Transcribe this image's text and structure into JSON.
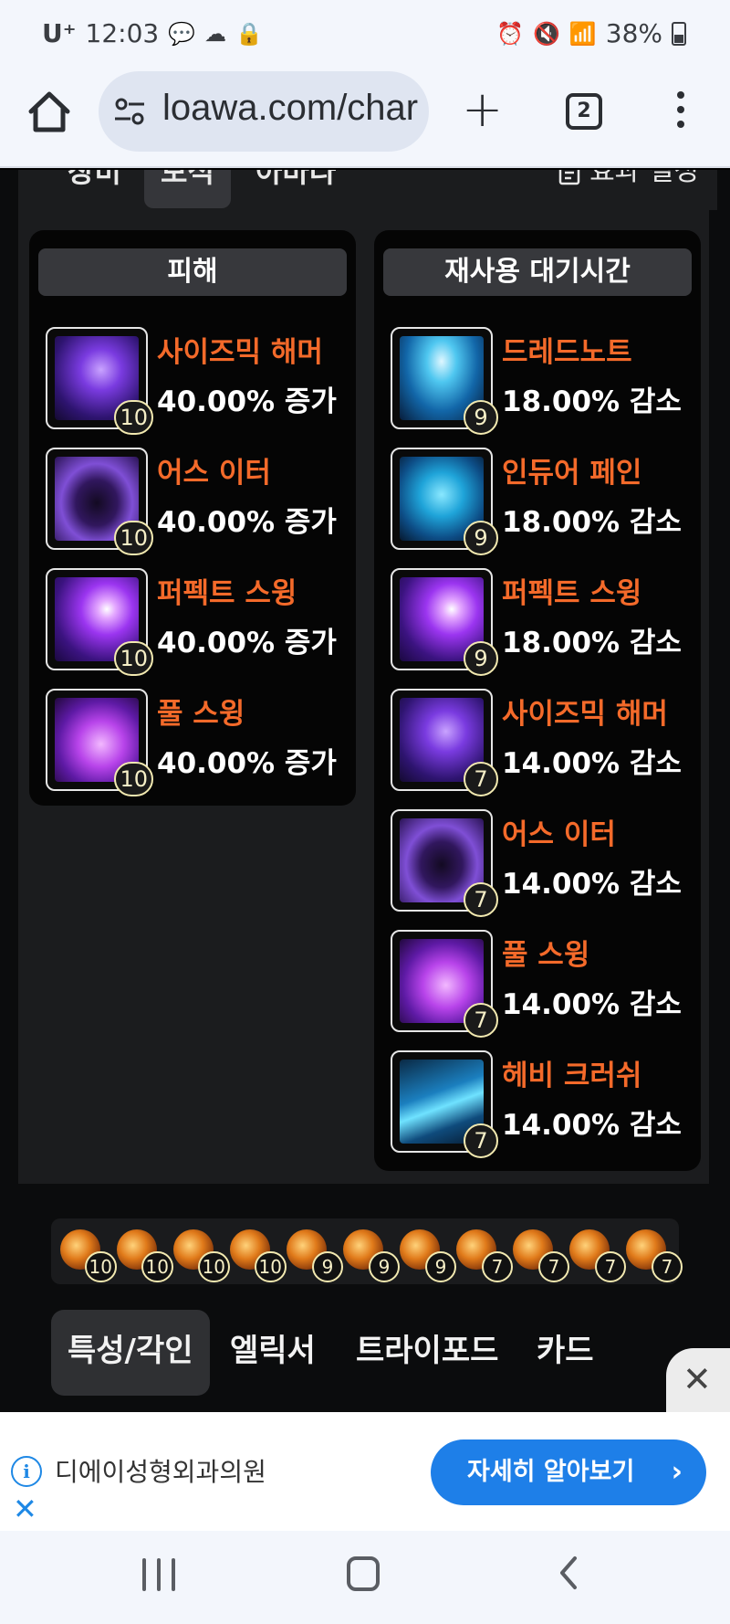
{
  "status_bar": {
    "carrier": "U⁺",
    "time": "12:03",
    "battery": "38%"
  },
  "browser": {
    "url": "loawa.com/char",
    "tab_count": "2"
  },
  "gem_tabs": {
    "items": [
      "장비",
      "보석",
      "아바타"
    ],
    "active": "보석",
    "effect_setting_label": "효과 설정"
  },
  "damage_panel": {
    "header": "피해",
    "gems": [
      {
        "name": "사이즈믹 해머",
        "effect": "40.00% 증가",
        "level": "10"
      },
      {
        "name": "어스 이터",
        "effect": "40.00% 증가",
        "level": "10"
      },
      {
        "name": "퍼펙트 스윙",
        "effect": "40.00% 증가",
        "level": "10"
      },
      {
        "name": "풀 스윙",
        "effect": "40.00% 증가",
        "level": "10"
      }
    ]
  },
  "cooldown_panel": {
    "header": "재사용 대기시간",
    "gems": [
      {
        "name": "드레드노트",
        "effect": "18.00% 감소",
        "level": "9"
      },
      {
        "name": "인듀어 페인",
        "effect": "18.00% 감소",
        "level": "9"
      },
      {
        "name": "퍼펙트 스윙",
        "effect": "18.00% 감소",
        "level": "9"
      },
      {
        "name": "사이즈믹 해머",
        "effect": "14.00% 감소",
        "level": "7"
      },
      {
        "name": "어스 이터",
        "effect": "14.00% 감소",
        "level": "7"
      },
      {
        "name": "풀 스윙",
        "effect": "14.00% 감소",
        "level": "7"
      },
      {
        "name": "헤비 크러쉬",
        "effect": "14.00% 감소",
        "level": "7"
      }
    ]
  },
  "gem_summary": {
    "levels": [
      "10",
      "10",
      "10",
      "10",
      "9",
      "9",
      "9",
      "7",
      "7",
      "7",
      "7"
    ]
  },
  "section_tabs": {
    "items": [
      "특성/각인",
      "엘릭서",
      "트라이포드",
      "카드"
    ],
    "active": "특성/각인"
  },
  "ad": {
    "advertiser": "디에이성형외과의원",
    "cta": "자세히 알아보기"
  }
}
